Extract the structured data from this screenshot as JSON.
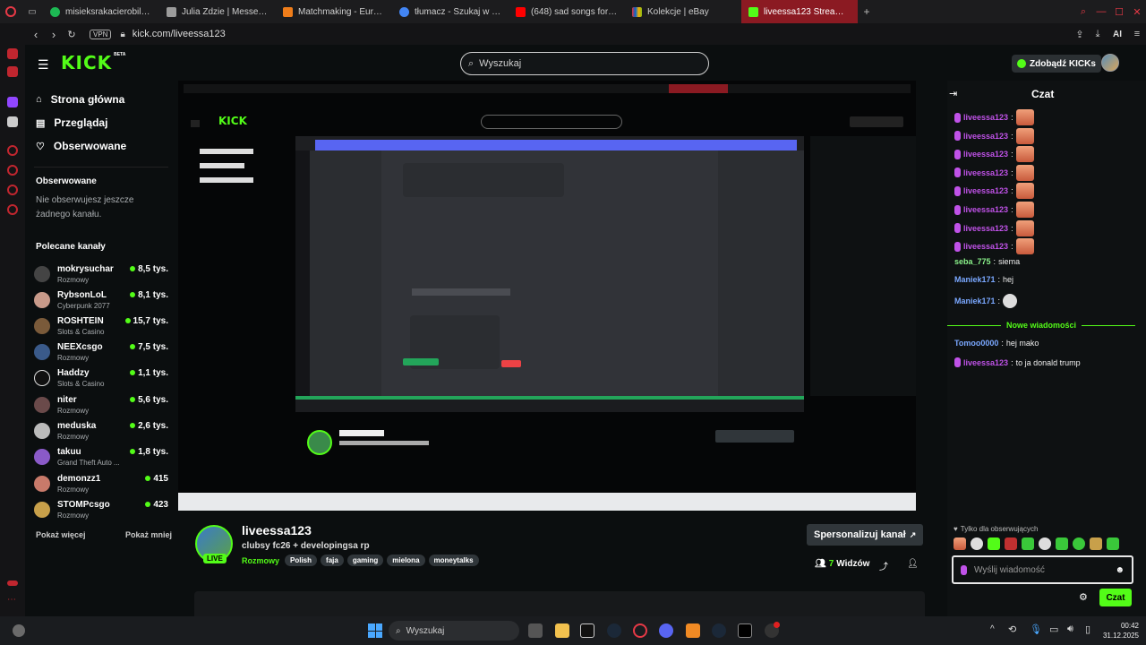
{
  "browser": {
    "tabs": [
      {
        "label": "misieksrakacierobila - play"
      },
      {
        "label": "Julia Zdzie | Messenger"
      },
      {
        "label": "Matchmaking - Europe 5v5"
      },
      {
        "label": "tłumacz - Szukaj w Google"
      },
      {
        "label": "(648) sad songs for sad p"
      },
      {
        "label": "Kolekcje | eBay"
      },
      {
        "label": "liveessa123 Stream - Watch"
      }
    ],
    "vpn_label": "VPN",
    "url": "kick.com/liveessa123",
    "ai_label": "AI"
  },
  "kick": {
    "logo_text": "KICK",
    "logo_badge": "BETA",
    "search_placeholder": "Wyszukaj",
    "get_kicks": "Zdobądź KICKs",
    "nav": [
      {
        "label": "Strona główna"
      },
      {
        "label": "Przeglądaj"
      },
      {
        "label": "Obserwowane"
      }
    ],
    "following_title": "Obserwowane",
    "following_empty": "Nie obserwujesz jeszcze żadnego kanału.",
    "recommended_title": "Polecane kanały",
    "channels": [
      {
        "name": "mokrysuchar",
        "category": "Rozmowy",
        "viewers": "8,5 tys."
      },
      {
        "name": "RybsonLoL",
        "category": "Cyberpunk 2077",
        "viewers": "8,1 tys."
      },
      {
        "name": "ROSHTEIN",
        "category": "Slots & Casino",
        "viewers": "15,7 tys."
      },
      {
        "name": "NEEXcsgo",
        "category": "Rozmowy",
        "viewers": "7,5 tys."
      },
      {
        "name": "Haddzy",
        "category": "Slots & Casino",
        "viewers": "1,1 tys."
      },
      {
        "name": "niter",
        "category": "Rozmowy",
        "viewers": "5,6 tys."
      },
      {
        "name": "meduska",
        "category": "Rozmowy",
        "viewers": "2,6 tys."
      },
      {
        "name": "takuu",
        "category": "Grand Theft Auto ...",
        "viewers": "1,8 tys."
      },
      {
        "name": "demonzz1",
        "category": "Rozmowy",
        "viewers": "415"
      },
      {
        "name": "STOMPcsgo",
        "category": "Rozmowy",
        "viewers": "423"
      }
    ],
    "show_more": "Pokaż więcej",
    "show_less": "Pokaż mniej"
  },
  "stream": {
    "channel": "liveessa123",
    "title": "clubsy fc26 + developingsa rp",
    "category": "Rozmowy",
    "tags": [
      "Polish",
      "faja",
      "gaming",
      "mielona",
      "moneytalks"
    ],
    "live_badge": "LIVE",
    "customize": "Spersonalizuj kanał",
    "viewers_count": "7",
    "viewers_label": "Widzów"
  },
  "chat": {
    "title": "Czat",
    "messages": [
      {
        "user": "liveessa123",
        "text": "",
        "color": "purple",
        "emote": true
      },
      {
        "user": "liveessa123",
        "text": "",
        "color": "purple",
        "emote": true
      },
      {
        "user": "liveessa123",
        "text": "",
        "color": "purple",
        "emote": true
      },
      {
        "user": "liveessa123",
        "text": "",
        "color": "purple",
        "emote": true
      },
      {
        "user": "liveessa123",
        "text": "",
        "color": "purple",
        "emote": true
      },
      {
        "user": "liveessa123",
        "text": "",
        "color": "purple",
        "emote": true
      },
      {
        "user": "liveessa123",
        "text": "",
        "color": "purple",
        "emote": true
      },
      {
        "user": "liveessa123",
        "text": "",
        "color": "purple",
        "emote": true
      },
      {
        "user": "seba_775",
        "text": "siema",
        "color": "green",
        "emote": false
      },
      {
        "user": "Maniek171",
        "text": "hej",
        "color": "blue",
        "emote": false
      },
      {
        "user": "Maniek171",
        "text": "",
        "color": "blue",
        "emote": true
      }
    ],
    "new_messages": "Nowe wiadomości",
    "messages_after": [
      {
        "user": "Tomoo0000",
        "text": "hej mako",
        "color": "blue"
      },
      {
        "user": "liveessa123",
        "text": "to ja donald trump",
        "color": "purple"
      }
    ],
    "followers_only": "Tylko dla obserwujących",
    "input_placeholder": "Wyślij wiadomość",
    "send_label": "Czat"
  },
  "taskbar": {
    "search_placeholder": "Wyszukaj",
    "time": "00:42",
    "date": "31.12.2025"
  }
}
